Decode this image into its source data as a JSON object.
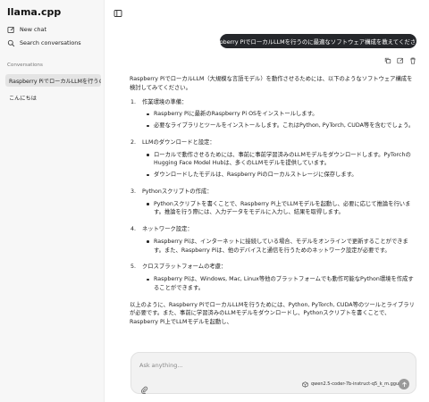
{
  "app": {
    "title": "llama.cpp"
  },
  "sidebar": {
    "new_chat": "New chat",
    "search": "Search conversations",
    "conversations_header": "Conversations",
    "conversations": [
      {
        "label": "Raspberry PiでローカルLLMを行うのに最適なソフトウェア構成を教えてください。",
        "active": true
      },
      {
        "label": "こんにちは",
        "active": false
      }
    ]
  },
  "user_message": "Raspberry PiでローカルLLMを行うのに最適なソフトウェア構成を教えてください。",
  "assistant": {
    "intro": "Raspberry PiでローカルLLM（大規模な言語モデル）を動作させるためには、以下のようなソフトウェア構成を検討してみてください。",
    "items": [
      {
        "num": "1.",
        "title": "作業環境の準備：",
        "bullets": [
          "Raspberry Piに最新のRaspberry Pi OSをインストールします。",
          "必要なライブラリとツールをインストールします。これはPython, PyTorch, CUDA等を含むでしょう。"
        ]
      },
      {
        "num": "2.",
        "title": "LLMのダウンロードと設定：",
        "bullets": [
          "ローカルで動作させるためには、事前に事前学習済みのLLMモデルをダウンロードします。PyTorchのHugging Face Model Hubは、多くのLLMモデルを提供しています。",
          "ダウンロードしたモデルは、Raspberry Piのローカルストレージに保存します。"
        ]
      },
      {
        "num": "3.",
        "title": "Pythonスクリプトの作成：",
        "bullets": [
          "Pythonスクリプトを書くことで、Raspberry Pi上でLLMモデルを起動し、必要に応じて推論を行います。推論を行う際には、入力データをモデルに入力し、結果を取得します。"
        ]
      },
      {
        "num": "4.",
        "title": "ネットワーク設定：",
        "bullets": [
          "Raspberry Piは、インターネットに接続している場合、モデルをオンラインで更新することができます。また、Raspberry Piは、他のデバイスと通信を行うためのネットワーク設定が必要です。"
        ]
      },
      {
        "num": "5.",
        "title": "クロスプラットフォームの考慮：",
        "bullets": [
          "Raspberry Piは、Windows, Mac, Linux等他のプラットフォームでも動作可能なPython環境を作成することができます。"
        ]
      }
    ],
    "outro": "以上のように、Raspberry PiでローカルLLMを行うためには、Python, PyTorch, CUDA等のツールとライブラリが必要です。また、事前に学習済みのLLMモデルをダウンロードし、Pythonスクリプトを書くことで、Raspberry Pi上でLLMモデルを起動し、"
  },
  "composer": {
    "placeholder": "Ask anything...",
    "model": "qwen2.5-coder-7b-instruct-q5_k_m.gguf"
  },
  "colors": {
    "bubble": "#25272b",
    "sidebar_bg": "#f7f7f7",
    "active_item": "#e4e4e4"
  }
}
